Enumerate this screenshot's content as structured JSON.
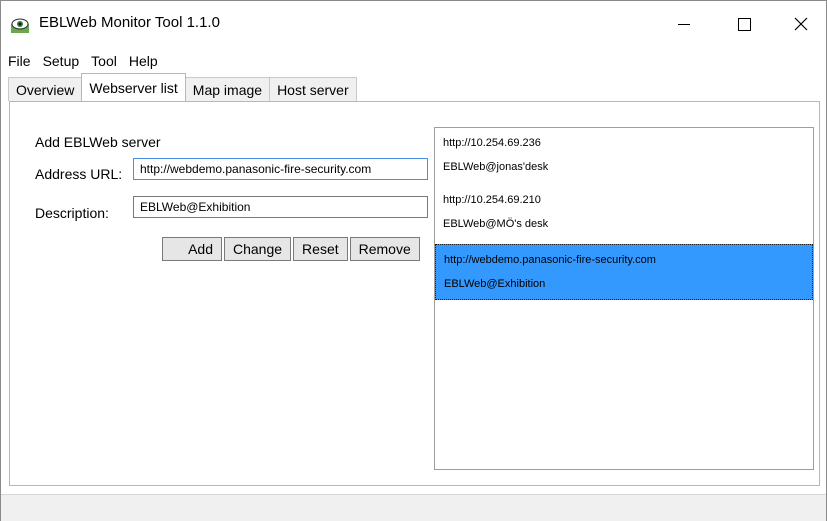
{
  "window": {
    "title": "EBLWeb Monitor Tool 1.1.0"
  },
  "menu": [
    "File",
    "Setup",
    "Tool",
    "Help"
  ],
  "tabs": [
    "Overview",
    "Webserver list",
    "Map image",
    "Host server"
  ],
  "active_tab": "Webserver list",
  "form": {
    "heading": "Add EBLWeb server",
    "address_label": "Address URL:",
    "address_value": "http://webdemo.panasonic-fire-security.com",
    "description_label": "Description:",
    "description_value": "EBLWeb@Exhibition",
    "buttons": {
      "add": "Add",
      "change": "Change",
      "reset": "Reset",
      "remove": "Remove"
    }
  },
  "servers": [
    {
      "url": "http://10.254.69.236",
      "description": "EBLWeb@jonas'desk"
    },
    {
      "url": "http://10.254.69.210",
      "description": "EBLWeb@MÖ's desk"
    },
    {
      "url": "http://webdemo.panasonic-fire-security.com",
      "description": "EBLWeb@Exhibition"
    }
  ],
  "selected_server_index": 2,
  "icons": {
    "app": "eye-icon",
    "minimize": "minimize-icon",
    "maximize": "maximize-icon",
    "close": "close-icon"
  }
}
